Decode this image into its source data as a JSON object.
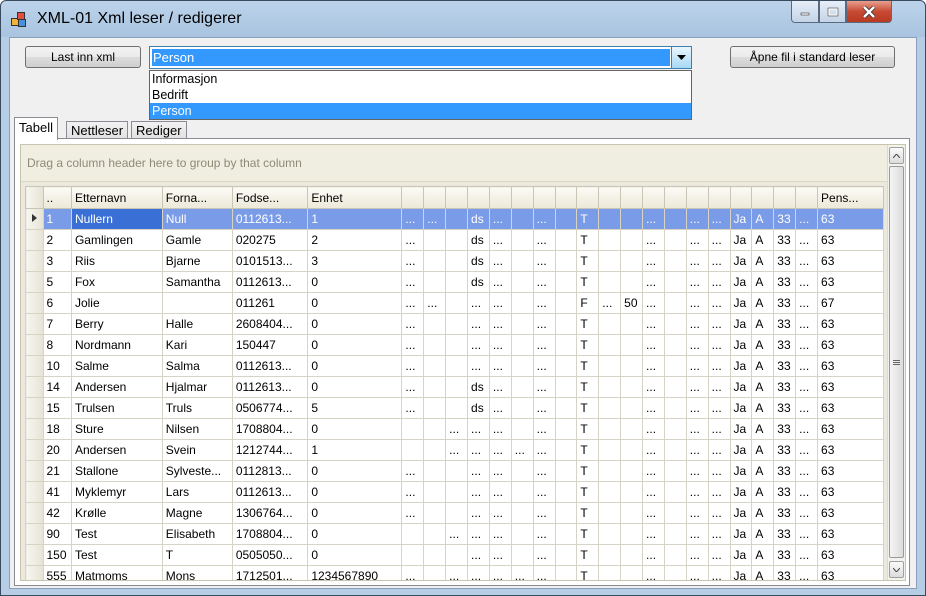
{
  "window": {
    "title": "XML-01 Xml leser / redigerer"
  },
  "toolbar": {
    "load_label": "Last inn xml",
    "open_label": "Åpne fil i standard leser"
  },
  "combo": {
    "value": "Person",
    "options": [
      "Informasjon",
      "Bedrift",
      "Person"
    ],
    "selected_index": 2
  },
  "tabs": [
    {
      "label": "Tabell",
      "active": true
    },
    {
      "label": "Nettleser"
    },
    {
      "label": "Rediger"
    }
  ],
  "grid": {
    "group_hint": "Drag a column header here to group by that column",
    "columns": [
      "..",
      "Etternavn",
      "Forna...",
      "Fodse...",
      "Enhet",
      "",
      "",
      "",
      "",
      "",
      "",
      "",
      "",
      "",
      "",
      "",
      "",
      "",
      "",
      "",
      "",
      "",
      "",
      "",
      "Pens..."
    ],
    "rows": [
      [
        "1",
        "Nullern",
        "Null",
        "0112613...",
        "1",
        "...",
        "...",
        "",
        "ds",
        "...",
        "",
        "...",
        "",
        "T",
        "",
        "",
        "...",
        "",
        "...",
        "...",
        "Ja",
        "A",
        "33",
        "...",
        "63"
      ],
      [
        "2",
        "Gamlingen",
        "Gamle",
        "020275",
        "2",
        "...",
        "",
        "",
        "ds",
        "...",
        "",
        "...",
        "",
        "T",
        "",
        "",
        "...",
        "",
        "...",
        "...",
        "Ja",
        "A",
        "33",
        "...",
        "63"
      ],
      [
        "3",
        "Riis",
        "Bjarne",
        "0101513...",
        "3",
        "...",
        "",
        "",
        "ds",
        "...",
        "",
        "...",
        "",
        "T",
        "",
        "",
        "...",
        "",
        "...",
        "...",
        "Ja",
        "A",
        "33",
        "...",
        "63"
      ],
      [
        "5",
        "Fox",
        "Samantha",
        "0112613...",
        "0",
        "...",
        "",
        "",
        "ds",
        "...",
        "",
        "...",
        "",
        "T",
        "",
        "",
        "...",
        "",
        "...",
        "...",
        "Ja",
        "A",
        "33",
        "...",
        "63"
      ],
      [
        "6",
        "Jolie",
        "",
        "011261",
        "0",
        "...",
        "...",
        "",
        "...",
        "...",
        "",
        "...",
        "",
        "F",
        "...",
        "50",
        "...",
        "",
        "...",
        "...",
        "Ja",
        "A",
        "33",
        "...",
        "67"
      ],
      [
        "7",
        "Berry",
        "Halle",
        "2608404...",
        "0",
        "...",
        "",
        "",
        "...",
        "...",
        "",
        "...",
        "",
        "T",
        "",
        "",
        "...",
        "",
        "...",
        "...",
        "Ja",
        "A",
        "33",
        "...",
        "63"
      ],
      [
        "8",
        "Nordmann",
        "Kari",
        "150447",
        "0",
        "...",
        "",
        "",
        "...",
        "...",
        "",
        "...",
        "",
        "T",
        "",
        "",
        "...",
        "",
        "...",
        "...",
        "Ja",
        "A",
        "33",
        "...",
        "63"
      ],
      [
        "10",
        "Salme",
        "Salma",
        "0112613...",
        "0",
        "...",
        "",
        "",
        "...",
        "...",
        "",
        "...",
        "",
        "T",
        "",
        "",
        "...",
        "",
        "...",
        "...",
        "Ja",
        "A",
        "33",
        "...",
        "63"
      ],
      [
        "14",
        "Andersen",
        "Hjalmar",
        "0112613...",
        "0",
        "...",
        "",
        "",
        "ds",
        "...",
        "",
        "...",
        "",
        "T",
        "",
        "",
        "...",
        "",
        "...",
        "...",
        "Ja",
        "A",
        "33",
        "...",
        "63"
      ],
      [
        "15",
        "Trulsen",
        "Truls",
        "0506774...",
        "5",
        "...",
        "",
        "",
        "ds",
        "...",
        "",
        "...",
        "",
        "T",
        "",
        "",
        "...",
        "",
        "...",
        "...",
        "Ja",
        "A",
        "33",
        "...",
        "63"
      ],
      [
        "18",
        "Sture",
        "Nilsen",
        "1708804...",
        "0",
        "",
        "",
        "...",
        "...",
        "...",
        "",
        "...",
        "",
        "T",
        "",
        "",
        "...",
        "",
        "...",
        "...",
        "Ja",
        "A",
        "33",
        "...",
        "63"
      ],
      [
        "20",
        "Andersen",
        "Svein",
        "1212744...",
        "1",
        "",
        "",
        "...",
        "...",
        "...",
        "...",
        "...",
        "",
        "T",
        "",
        "",
        "...",
        "",
        "...",
        "...",
        "Ja",
        "A",
        "33",
        "...",
        "63"
      ],
      [
        "21",
        "Stallone",
        "Sylveste...",
        "0112813...",
        "0",
        "...",
        "",
        "",
        "...",
        "...",
        "",
        "...",
        "",
        "T",
        "",
        "",
        "...",
        "",
        "...",
        "...",
        "Ja",
        "A",
        "33",
        "...",
        "63"
      ],
      [
        "41",
        "Myklemyr",
        "Lars",
        "0112613...",
        "0",
        "...",
        "",
        "",
        "...",
        "...",
        "",
        "...",
        "",
        "T",
        "",
        "",
        "...",
        "",
        "...",
        "...",
        "Ja",
        "A",
        "33",
        "...",
        "63"
      ],
      [
        "42",
        "Krølle",
        "Magne",
        "1306764...",
        "0",
        "...",
        "",
        "",
        "...",
        "...",
        "",
        "...",
        "",
        "T",
        "",
        "",
        "...",
        "",
        "...",
        "...",
        "Ja",
        "A",
        "33",
        "...",
        "63"
      ],
      [
        "90",
        "Test",
        "Elisabeth",
        "1708804...",
        "0",
        "",
        "",
        "...",
        "...",
        "...",
        "",
        "...",
        "",
        "T",
        "",
        "",
        "...",
        "",
        "...",
        "...",
        "Ja",
        "A",
        "33",
        "...",
        "63"
      ],
      [
        "150",
        "Test",
        "T",
        "0505050...",
        "0",
        "",
        "",
        "",
        "...",
        "...",
        "",
        "...",
        "",
        "T",
        "",
        "",
        "...",
        "",
        "...",
        "...",
        "Ja",
        "A",
        "33",
        "...",
        "63"
      ],
      [
        "555",
        "Matmoms",
        "Mons",
        "1712501...",
        "1234567890",
        "...",
        "",
        "...",
        "...",
        "...",
        "...",
        "...",
        "",
        "T",
        "",
        "",
        "...",
        "",
        "...",
        "...",
        "Ja",
        "A",
        "33",
        "...",
        "63"
      ]
    ]
  },
  "colors": {
    "selection": "#3399ff",
    "selected_row": "#7a9ce8",
    "close_button": "#c74a33"
  },
  "icons": [
    "app-icon",
    "minimize-icon",
    "maximize-icon",
    "close-icon",
    "dropdown-arrow-icon",
    "row-pointer-icon",
    "scroll-up-icon",
    "scroll-down-icon",
    "scroll-grip-icon"
  ]
}
